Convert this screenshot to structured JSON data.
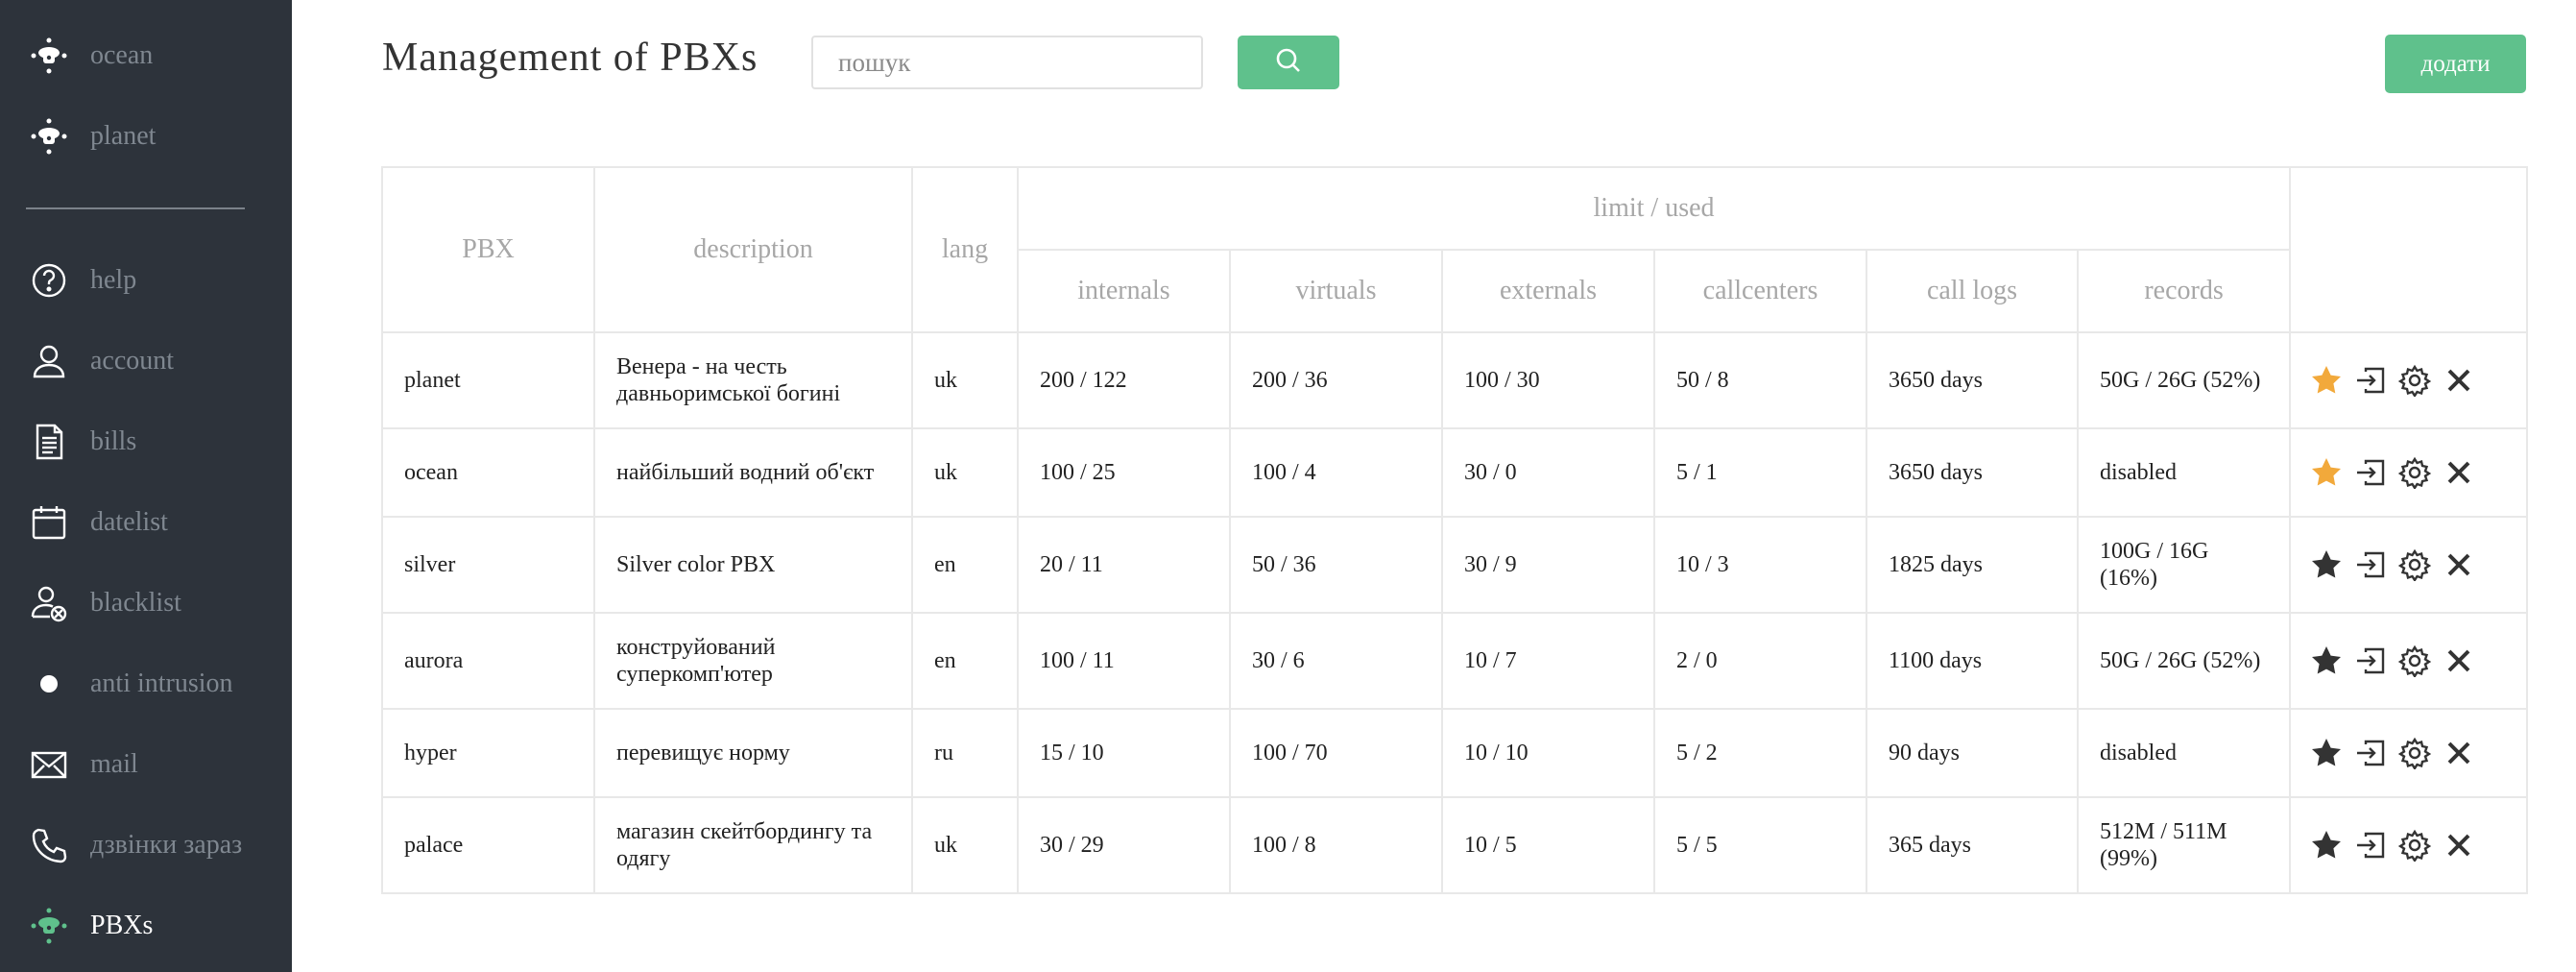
{
  "sidebar": {
    "items": [
      {
        "label": "ocean",
        "icon": "pbx-icon"
      },
      {
        "label": "planet",
        "icon": "pbx-icon"
      },
      {
        "label": "help",
        "icon": "help-icon"
      },
      {
        "label": "account",
        "icon": "user-icon"
      },
      {
        "label": "bills",
        "icon": "document-icon"
      },
      {
        "label": "datelist",
        "icon": "calendar-icon"
      },
      {
        "label": "blacklist",
        "icon": "user-block-icon"
      },
      {
        "label": "anti intrusion",
        "icon": "dot-icon"
      },
      {
        "label": "mail",
        "icon": "mail-icon"
      },
      {
        "label": "дзвінки зараз",
        "icon": "phone-icon"
      },
      {
        "label": "PBXs",
        "icon": "pbx-icon",
        "active": true
      }
    ]
  },
  "header": {
    "title": "Management of PBXs",
    "search_placeholder": "пошук",
    "add_label": "додати"
  },
  "table": {
    "headers": {
      "pbx": "PBX",
      "description": "description",
      "lang": "lang",
      "limit_used": "limit / used",
      "internals": "internals",
      "virtuals": "virtuals",
      "externals": "externals",
      "callcenters": "callcenters",
      "call_logs": "call logs",
      "records": "records"
    },
    "rows": [
      {
        "pbx": "planet",
        "description": "Венера - на честь давньоримської богині",
        "lang": "uk",
        "internals": "200 / 122",
        "virtuals": "200 / 36",
        "externals": "100 / 30",
        "callcenters": "50 / 8",
        "call_logs": "3650 days",
        "records": "50G / 26G (52%)",
        "favorite": true
      },
      {
        "pbx": "ocean",
        "description": "найбільший водний об'єкт",
        "lang": "uk",
        "internals": "100 / 25",
        "virtuals": "100 / 4",
        "externals": "30 / 0",
        "callcenters": "5 / 1",
        "call_logs": "3650 days",
        "records": "disabled",
        "favorite": true
      },
      {
        "pbx": "silver",
        "description": "Silver color PBX",
        "lang": "en",
        "internals": "20 / 11",
        "virtuals": "50 / 36",
        "externals": "30 / 9",
        "callcenters": "10 / 3",
        "call_logs": "1825 days",
        "records": "100G / 16G (16%)",
        "favorite": false
      },
      {
        "pbx": "aurora",
        "description": "конструйований суперкомп'ютер",
        "lang": "en",
        "internals": "100 / 11",
        "virtuals": "30 / 6",
        "externals": "10 / 7",
        "callcenters": "2 / 0",
        "call_logs": "1100 days",
        "records": "50G / 26G (52%)",
        "favorite": false
      },
      {
        "pbx": "hyper",
        "description": "перевищує норму",
        "lang": "ru",
        "internals": "15 / 10",
        "virtuals": "100 / 70",
        "externals": "10 / 10",
        "callcenters": "5 / 2",
        "call_logs": "90 days",
        "records": "disabled",
        "favorite": false
      },
      {
        "pbx": "palace",
        "description": "магазин скейтбордингу та одягу",
        "lang": "uk",
        "internals": "30 / 29",
        "virtuals": "100 / 8",
        "externals": "10 / 5",
        "callcenters": "5 / 5",
        "call_logs": "365 days",
        "records": "512M / 511M (99%)",
        "favorite": false
      }
    ]
  },
  "colors": {
    "sidebar_bg": "#2d333b",
    "accent_green": "#5fc18c",
    "star_favorite": "#f2a93b",
    "star_default": "#333333"
  }
}
